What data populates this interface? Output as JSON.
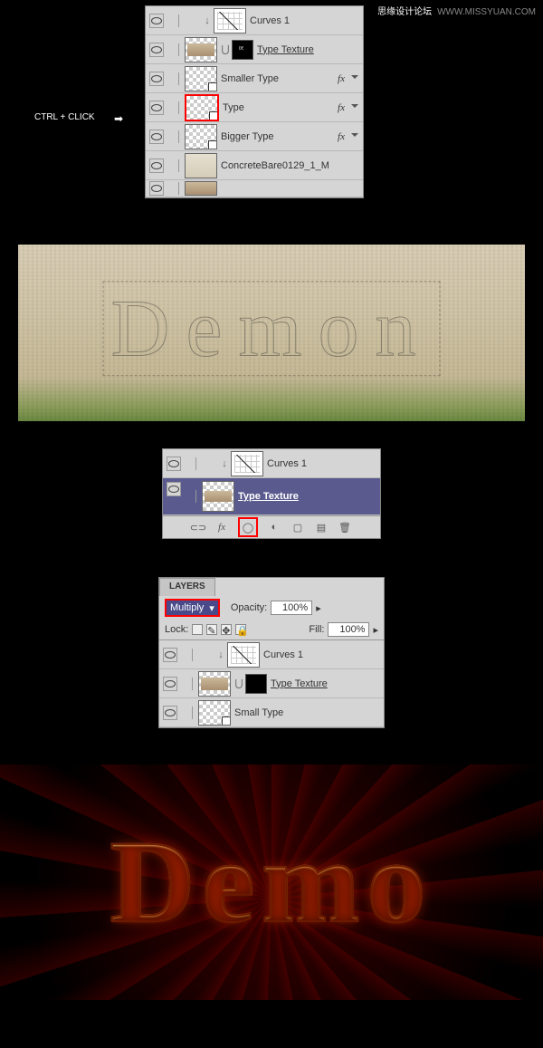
{
  "watermark": {
    "cn": "思缘设计论坛",
    "en": "WWW.MISSYUAN.COM"
  },
  "hint": "CTRL + CLICK",
  "p1": {
    "layers": [
      {
        "name": "Curves 1"
      },
      {
        "name": "Type Texture"
      },
      {
        "name": "Smaller Type",
        "fx": "fx"
      },
      {
        "name": "Type",
        "fx": "fx"
      },
      {
        "name": "Bigger Type",
        "fx": "fx"
      },
      {
        "name": "ConcreteBare0129_1_M"
      }
    ]
  },
  "demon": "Demon",
  "p2": {
    "layers": [
      {
        "name": "Curves 1"
      },
      {
        "name": "Type Texture"
      }
    ]
  },
  "p3": {
    "tab": "LAYERS",
    "blend": "Multiply",
    "opacity_l": "Opacity:",
    "opacity": "100%",
    "lock": "Lock:",
    "fill_l": "Fill:",
    "fill": "100%",
    "layers": [
      {
        "name": "Curves 1"
      },
      {
        "name": "Type Texture"
      },
      {
        "name": "Small Type"
      }
    ]
  },
  "gold": "Demo"
}
